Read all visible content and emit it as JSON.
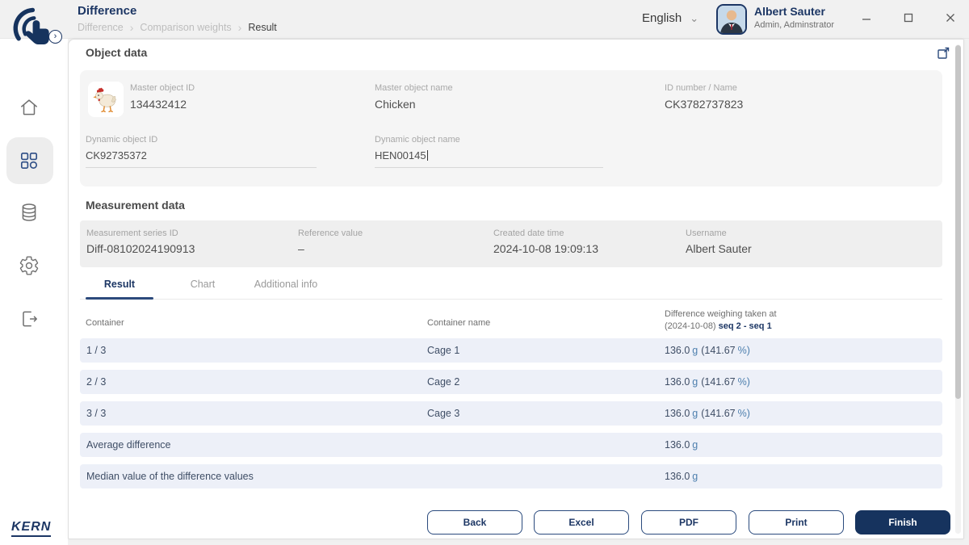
{
  "header": {
    "title": "Difference",
    "breadcrumb": {
      "0": "Difference",
      "1": "Comparison weights",
      "2": "Result"
    },
    "separator": "›",
    "language": "English",
    "language_chevron": "⌄",
    "user": {
      "name": "Albert Sauter",
      "role": "Admin, Adminstrator"
    }
  },
  "sidebar": {
    "brand": "KERN"
  },
  "object_data": {
    "heading": "Object data",
    "master_object_id": {
      "label": "Master object ID",
      "value": "134432412"
    },
    "master_object_name": {
      "label": "Master object name",
      "value": "Chicken"
    },
    "id_number_name": {
      "label": "ID number / Name",
      "value": "CK3782737823"
    },
    "dynamic_object_id": {
      "label": "Dynamic object ID",
      "value": "CK92735372"
    },
    "dynamic_object_name": {
      "label": "Dynamic object name",
      "value": "HEN00145"
    }
  },
  "measurement_data": {
    "heading": "Measurement data",
    "series_id": {
      "label": "Measurement series ID",
      "value": "Diff-08102024190913"
    },
    "reference_value": {
      "label": "Reference value",
      "value": "–"
    },
    "created": {
      "label": "Created date time",
      "value": "2024-10-08 19:09:13"
    },
    "username": {
      "label": "Username",
      "value": "Albert Sauter"
    },
    "tabs": {
      "0": "Result",
      "1": "Chart",
      "2": "Additional info"
    }
  },
  "result_table": {
    "col_container": "Container",
    "col_name": "Container name",
    "col_diff_line1": "Difference weighing taken at",
    "col_diff_prefix": "(2024-10-08)",
    "col_diff_seq": "seq 2 - seq 1",
    "rows": {
      "0": {
        "container": "1 / 3",
        "name": "Cage 1",
        "value": "136.0",
        "unit": "g",
        "pct": "(141.67",
        "pct_unit": "%)"
      },
      "1": {
        "container": "2 / 3",
        "name": "Cage 2",
        "value": "136.0",
        "unit": "g",
        "pct": "(141.67",
        "pct_unit": "%)"
      },
      "2": {
        "container": "3 / 3",
        "name": "Cage 3",
        "value": "136.0",
        "unit": "g",
        "pct": "(141.67",
        "pct_unit": "%)"
      }
    },
    "summary": {
      "0": {
        "label": "Average difference",
        "value": "136.0",
        "unit": "g"
      },
      "1": {
        "label": "Median value of the difference values",
        "value": "136.0",
        "unit": "g"
      }
    }
  },
  "actions": {
    "back": "Back",
    "excel": "Excel",
    "pdf": "PDF",
    "print": "Print",
    "finish": "Finish"
  }
}
